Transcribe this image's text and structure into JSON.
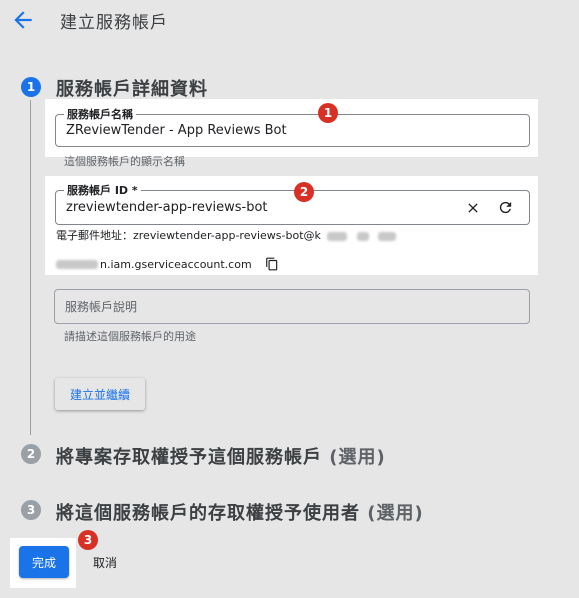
{
  "header": {
    "title": "建立服務帳戶"
  },
  "steps": [
    {
      "number": "1",
      "title": "服務帳戶詳細資料",
      "optional": ""
    },
    {
      "number": "2",
      "title": "將專案存取權授予這個服務帳戶",
      "optional": "(選用)"
    },
    {
      "number": "3",
      "title": "將這個服務帳戶的存取權授予使用者",
      "optional": "(選用)"
    }
  ],
  "form": {
    "name": {
      "label": "服務帳戶名稱",
      "value": "ZReviewTender - App Reviews Bot",
      "helper": "這個服務帳戶的顯示名稱"
    },
    "id": {
      "label": "服務帳戶 ID *",
      "value": "zreviewtender-app-reviews-bot",
      "email_prefix": "電子郵件地址：zreviewtender-app-reviews-bot@k",
      "email_suffix": "n.iam.gserviceaccount.com"
    },
    "description": {
      "placeholder": "服務帳戶說明",
      "helper": "請描述這個服務帳戶的用途"
    },
    "create_continue_label": "建立並繼續"
  },
  "annotations": [
    "1",
    "2",
    "3"
  ],
  "footer": {
    "done_label": "完成",
    "cancel_label": "取消"
  },
  "colors": {
    "accent": "#1a73e8",
    "badge": "#d93025",
    "background": "#e6e6e6"
  }
}
